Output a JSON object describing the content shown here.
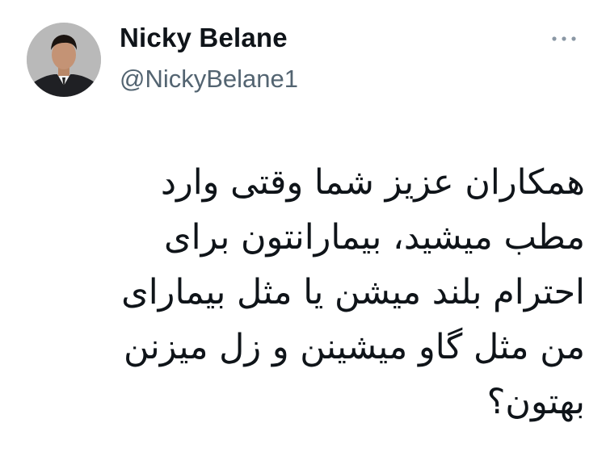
{
  "author": {
    "display_name": "Nicky Belane",
    "handle": "@NickyBelane1",
    "avatar_icon": "profile-photo"
  },
  "more_icon": "more-horizontal-icon",
  "tweet": {
    "lines": [
      "همکاران عزیز شما وقتی وارد",
      "مطب میشید، بیمارانتون برای",
      "احترام بلند میشن یا مثل بیمارای",
      "من مثل گاو میشینن و زل میزنن",
      "بهتون؟"
    ]
  },
  "colors": {
    "text": "#0f1419",
    "secondary": "#536471",
    "background": "#ffffff"
  }
}
